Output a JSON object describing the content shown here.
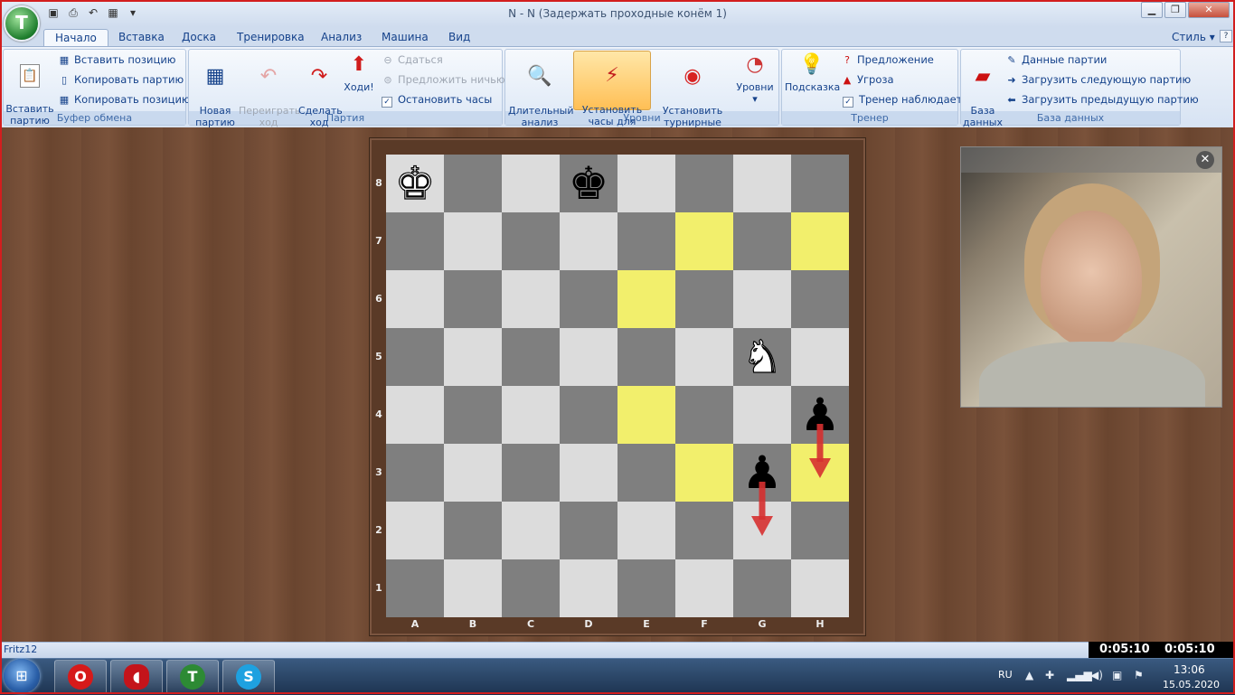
{
  "window": {
    "title": "N - N  (Задержать проходные конём 1)",
    "app_logo": "T",
    "qat": [
      "save-icon",
      "print-icon",
      "undo-icon",
      "board-icon",
      "dropdown-icon"
    ],
    "controls": [
      "minimize-icon",
      "restore-icon",
      "close-icon"
    ]
  },
  "tabs": [
    "Начало",
    "Вставка",
    "Доска",
    "Тренировка",
    "Анализ",
    "Машина",
    "Вид"
  ],
  "style_label": "Стиль",
  "ribbon": {
    "clipboard": {
      "title": "Буфер обмена",
      "paste_big": "Вставить\nпартию",
      "paste_position": "Вставить позицию",
      "copy_game": "Копировать партию",
      "copy_position": "Копировать позицию"
    },
    "game": {
      "title": "Партия",
      "new_game": "Новая\nпартию",
      "takeback": "Переиграть\nход",
      "make_move": "Сделать\nход",
      "move_now": "Ходи!",
      "resign": "Сдаться",
      "offer_draw": "Предложить ничью",
      "stop_clock": "Остановить часы"
    },
    "levels": {
      "title": "Уровни",
      "infinite_analysis": "Длительный\nанализ",
      "blitz_clock": "Установить\nчасы для блица",
      "tournament_clock": "Установить\nтурнирные часы",
      "levels": "Уровни"
    },
    "coach": {
      "title": "Тренер",
      "hint": "Подсказка",
      "suggestion": "Предложение",
      "threat": "Угроза",
      "coach_watching": "Тренер наблюдает"
    },
    "database": {
      "title": "База данных",
      "database_big": "База\nданных",
      "game_data": "Данные партии",
      "load_next": "Загрузить следующую партию",
      "load_prev": "Загрузить предыдущую партию"
    }
  },
  "board": {
    "files": [
      "A",
      "B",
      "C",
      "D",
      "E",
      "F",
      "G",
      "H"
    ],
    "ranks": [
      "8",
      "7",
      "6",
      "5",
      "4",
      "3",
      "2",
      "1"
    ],
    "pieces": {
      "a8": {
        "glyph": "♚",
        "color": "white",
        "name": "white-king-icon"
      },
      "d8": {
        "glyph": "♚",
        "color": "black",
        "name": "black-king-icon"
      },
      "g5": {
        "glyph": "♞",
        "color": "white",
        "name": "white-knight-icon"
      },
      "h4": {
        "glyph": "♟",
        "color": "black",
        "name": "black-pawn-icon"
      },
      "g3": {
        "glyph": "♟",
        "color": "black",
        "name": "black-pawn-icon"
      }
    },
    "highlighted": [
      "f7",
      "h7",
      "e6",
      "e4",
      "f3",
      "h3"
    ],
    "arrows": [
      {
        "from": "g3",
        "to": "g2"
      },
      {
        "from": "h4",
        "to": "h3"
      }
    ]
  },
  "status": {
    "engine": "Fritz12",
    "clock_white": "0:05:10",
    "clock_black": "0:05:10"
  },
  "taskbar": {
    "lang": "RU",
    "time": "13:06",
    "date": "15.05.2020"
  }
}
